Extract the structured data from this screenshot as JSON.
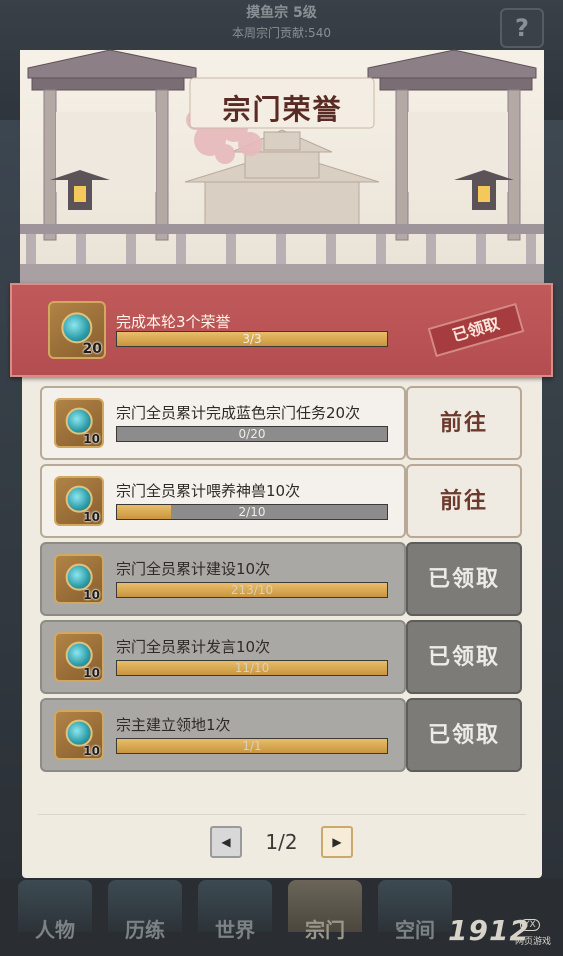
{
  "header": {
    "sect_name": "摸鱼宗 5级",
    "weekly_contribution": "本周宗门贡献:540",
    "help_label": "?"
  },
  "modal": {
    "title": "宗门荣誉"
  },
  "round_task": {
    "text": "完成本轮3个荣誉",
    "progress": "3/3",
    "progress_fraction": 1.0,
    "reward_qty": "20",
    "stamp": "已领取"
  },
  "tasks": [
    {
      "text": "宗门全员累计完成蓝色宗门任务20次",
      "progress": "0/20",
      "progress_fraction": 0.0,
      "reward_qty": "10",
      "action": "前往",
      "state": "go"
    },
    {
      "text": "宗门全员累计喂养神兽10次",
      "progress": "2/10",
      "progress_fraction": 0.2,
      "reward_qty": "10",
      "action": "前往",
      "state": "go"
    },
    {
      "text": "宗门全员累计建设10次",
      "progress": "213/10",
      "progress_fraction": 1.0,
      "reward_qty": "10",
      "action": "已领取",
      "state": "done"
    },
    {
      "text": "宗门全员累计发言10次",
      "progress": "11/10",
      "progress_fraction": 1.0,
      "reward_qty": "10",
      "action": "已领取",
      "state": "done"
    },
    {
      "text": "宗主建立领地1次",
      "progress": "1/1",
      "progress_fraction": 1.0,
      "reward_qty": "10",
      "action": "已领取",
      "state": "done"
    }
  ],
  "pagination": {
    "label": "1/2",
    "prev_icon": "◀",
    "next_icon": "▶"
  },
  "bottom_nav": [
    {
      "label": "人物"
    },
    {
      "label": "历练"
    },
    {
      "label": "世界"
    },
    {
      "label": "宗门",
      "active": true
    },
    {
      "label": "空间"
    }
  ],
  "watermark": {
    "brand": "1912",
    "badge": "YX",
    "sub": "网页游戏"
  },
  "colors": {
    "round_bar": "#b34d50",
    "progress_fill": "#d8a852",
    "go_button_text": "#6b3a2c",
    "done_button_bg": "#7c7b78"
  }
}
